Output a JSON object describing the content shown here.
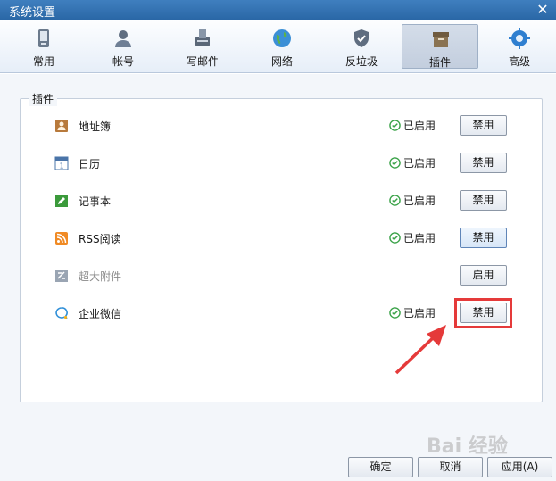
{
  "window": {
    "title": "系统设置"
  },
  "toolbar": {
    "items": [
      {
        "label": "常用",
        "icon": "phone-icon"
      },
      {
        "label": "帐号",
        "icon": "user-icon"
      },
      {
        "label": "写邮件",
        "icon": "compose-icon"
      },
      {
        "label": "网络",
        "icon": "globe-icon"
      },
      {
        "label": "反垃圾",
        "icon": "shield-icon"
      },
      {
        "label": "插件",
        "icon": "box-icon",
        "active": true
      },
      {
        "label": "高级",
        "icon": "gear-icon"
      }
    ]
  },
  "plugins": {
    "legend": "插件",
    "rows": [
      {
        "name": "地址簿",
        "status": "已启用",
        "button": "禁用",
        "icon": "addressbook-icon"
      },
      {
        "name": "日历",
        "status": "已启用",
        "button": "禁用",
        "icon": "calendar-icon"
      },
      {
        "name": "记事本",
        "status": "已启用",
        "button": "禁用",
        "icon": "notepad-icon"
      },
      {
        "name": "RSS阅读",
        "status": "已启用",
        "button": "禁用",
        "icon": "rss-icon"
      },
      {
        "name": "超大附件",
        "status": "",
        "button": "启用",
        "icon": "attachment-icon",
        "disabled": true
      },
      {
        "name": "企业微信",
        "status": "已启用",
        "button": "禁用",
        "icon": "wecom-icon"
      }
    ]
  },
  "footer": {
    "ok": "确定",
    "cancel": "取消",
    "apply": "应用(A)"
  },
  "watermark": "Bai 经验",
  "colors": {
    "accent": "#2a67a6",
    "highlight": "#e53a3a",
    "enabled": "#3ca34a"
  }
}
